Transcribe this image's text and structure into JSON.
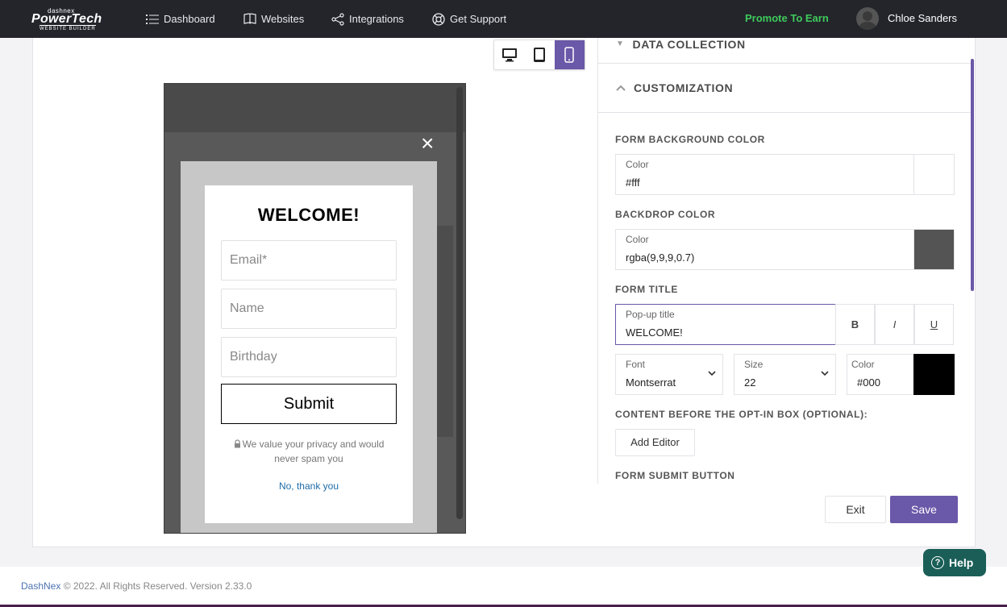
{
  "brand": {
    "small": "dashnex",
    "big": "PowerTech",
    "sub": "WEBSITE BUILDER"
  },
  "nav": {
    "items": [
      {
        "label": "Dashboard",
        "icon": "list-icon"
      },
      {
        "label": "Websites",
        "icon": "book-icon"
      },
      {
        "label": "Integrations",
        "icon": "share-icon"
      },
      {
        "label": "Get Support",
        "icon": "lifebuoy-icon"
      }
    ],
    "promote": "Promote To Earn",
    "user": "Chloe Sanders"
  },
  "devices": {
    "options": [
      "desktop",
      "tablet",
      "mobile"
    ],
    "active": "mobile"
  },
  "preview": {
    "close": "×",
    "title": "WELCOME!",
    "fields": [
      "Email*",
      "Name",
      "Birthday"
    ],
    "submit": "Submit",
    "privacy": "We value your privacy and would never spam you",
    "no_thanks": "No, thank you"
  },
  "panel": {
    "sections": {
      "data_collection": "DATA COLLECTION",
      "customization": "CUSTOMIZATION"
    },
    "form_bg": {
      "label": "FORM BACKGROUND COLOR",
      "field_label": "Color",
      "value": "#fff",
      "swatch": "#ffffff"
    },
    "backdrop": {
      "label": "BACKDROP COLOR",
      "field_label": "Color",
      "value": "rgba(9,9,9,0.7)",
      "swatch": "#545454"
    },
    "form_title": {
      "label": "FORM TITLE",
      "field_label": "Pop-up title",
      "value": "WELCOME!",
      "bold": "B",
      "italic": "I",
      "underline": "U",
      "font_label": "Font",
      "font_value": "Montserrat",
      "size_label": "Size",
      "size_value": "22",
      "color_label": "Color",
      "color_value": "#000",
      "swatch": "#000000"
    },
    "content_before": {
      "label": "CONTENT BEFORE THE OPT-IN BOX (OPTIONAL):",
      "button": "Add Editor"
    },
    "submit_button": {
      "label": "FORM SUBMIT BUTTON"
    }
  },
  "actions": {
    "exit": "Exit",
    "save": "Save"
  },
  "help": {
    "label": "Help"
  },
  "footer": {
    "link": "DashNex",
    "text": " © 2022. All Rights Reserved. Version 2.33.0"
  },
  "colors": {
    "accent": "#6a58a8",
    "promote": "#3fca5b",
    "help": "#1a5e57",
    "nav": "#23252b"
  }
}
